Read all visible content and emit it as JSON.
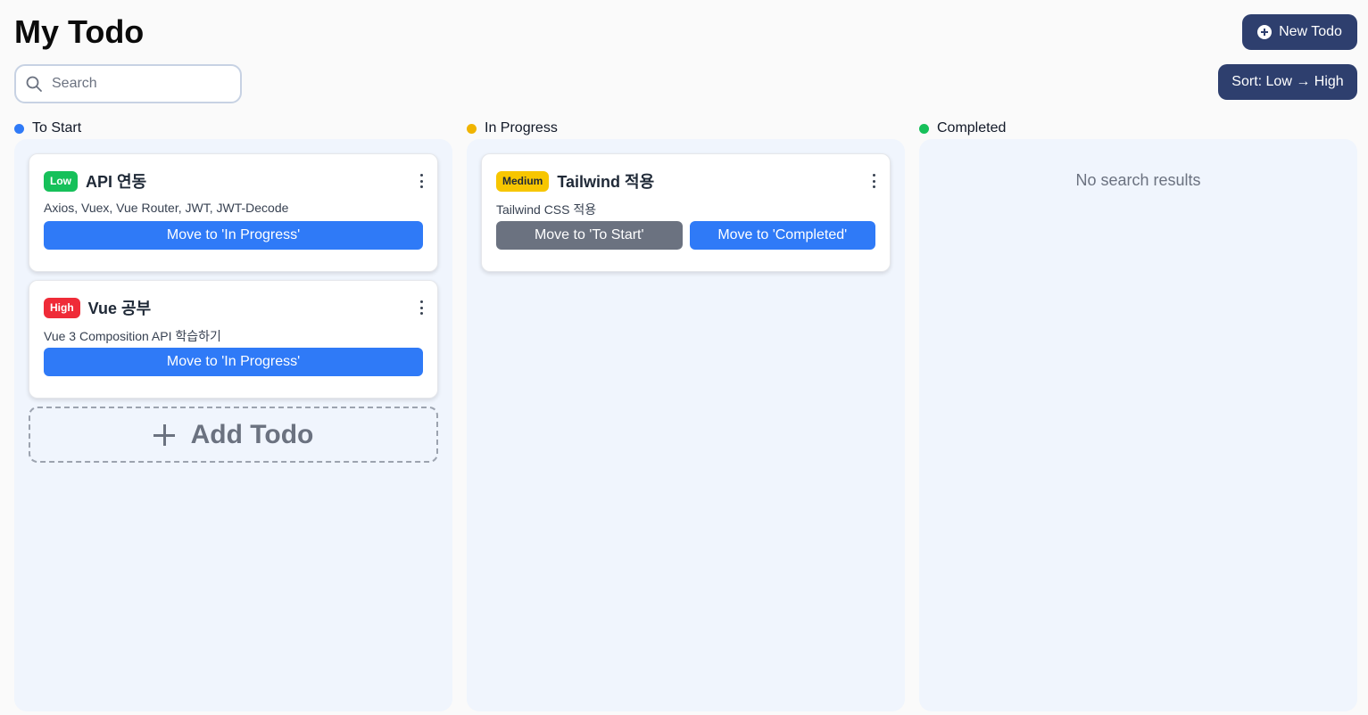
{
  "header": {
    "title": "My Todo",
    "new_todo_label": "New Todo",
    "sort_label": "Sort: Low → High"
  },
  "search": {
    "placeholder": "Search",
    "value": ""
  },
  "colors": {
    "to_start": "#2f7af7",
    "in_progress": "#f0b400",
    "completed": "#16c05a",
    "low": "#16c05a",
    "medium": "#f7c600",
    "high": "#ef2b38",
    "primary_dark": "#2e3f6e"
  },
  "columns": [
    {
      "title": "To Start",
      "cards": [
        {
          "priority": "Low",
          "title": "API 연동",
          "description": "Axios, Vuex, Vue Router, JWT, JWT-Decode",
          "actions": [
            "Move to 'In Progress'"
          ]
        },
        {
          "priority": "High",
          "title": "Vue 공부",
          "description": "Vue 3 Composition API 학습하기",
          "actions": [
            "Move to 'In Progress'"
          ]
        }
      ],
      "add_label": "Add Todo"
    },
    {
      "title": "In Progress",
      "cards": [
        {
          "priority": "Medium",
          "title": "Tailwind 적용",
          "description": "Tailwind CSS 적용",
          "actions": [
            "Move to 'To Start'",
            "Move to 'Completed'"
          ]
        }
      ]
    },
    {
      "title": "Completed",
      "cards": [],
      "empty_message": "No search results"
    }
  ]
}
